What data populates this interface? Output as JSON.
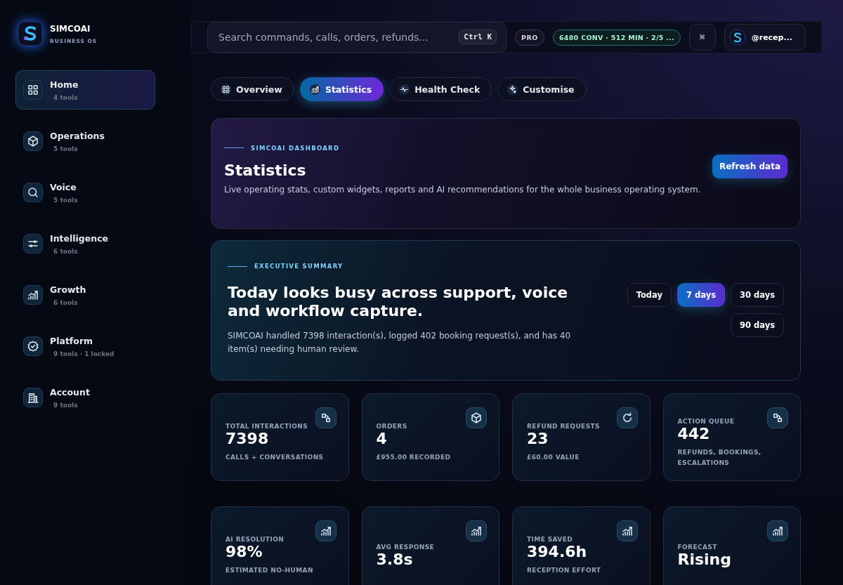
{
  "brand": {
    "name": "SIMCOAI",
    "tagline": "BUSINESS OS"
  },
  "sidebar": {
    "items": [
      {
        "label": "Home",
        "meta": "4 tools",
        "selected": true
      },
      {
        "label": "Operations",
        "meta": "5 tools",
        "selected": false
      },
      {
        "label": "Voice",
        "meta": "5 tools",
        "selected": false
      },
      {
        "label": "Intelligence",
        "meta": "6 tools",
        "selected": false
      },
      {
        "label": "Growth",
        "meta": "6 tools",
        "selected": false
      },
      {
        "label": "Platform",
        "meta": "9 tools · 1 locked",
        "selected": false
      },
      {
        "label": "Account",
        "meta": "9 tools",
        "selected": false
      }
    ]
  },
  "topbar": {
    "search": {
      "placeholder": "Search commands, calls, orders, refunds..."
    },
    "shortcut": "Ctrl K",
    "plan": "PRO",
    "usage": "6480 CONV · 512 MIN · 2/5 ...",
    "shortcut_icon": "⌘",
    "user": "@recep..."
  },
  "tabs": [
    {
      "label": "Overview",
      "selected": false
    },
    {
      "label": "Statistics",
      "selected": true
    },
    {
      "label": "Health Check",
      "selected": false
    },
    {
      "label": "Customise",
      "selected": false
    }
  ],
  "hero": {
    "eyebrow": "SIMCOAI DASHBOARD",
    "title": "Statistics",
    "subtitle": "Live operating stats, custom widgets, reports and AI recommendations for the whole business operating system.",
    "button": "Refresh data"
  },
  "summary": {
    "eyebrow": "EXECUTIVE SUMMARY",
    "title": "Today looks busy across support, voice and workflow capture.",
    "text": "SIMCOAI handled 7398 interaction(s), logged 402 booking request(s), and has 40 item(s) needing human review.",
    "ranges": [
      {
        "label": "Today",
        "selected": false
      },
      {
        "label": "7 days",
        "selected": true
      },
      {
        "label": "30 days",
        "selected": false
      },
      {
        "label": "90 days",
        "selected": false
      }
    ]
  },
  "stats": [
    {
      "label": "TOTAL INTERACTIONS",
      "value": "7398",
      "sub": "CALLS + CONVERSATIONS"
    },
    {
      "label": "ORDERS",
      "value": "4",
      "sub": "£955.00 RECORDED"
    },
    {
      "label": "REFUND REQUESTS",
      "value": "23",
      "sub": "£60.00 VALUE"
    },
    {
      "label": "ACTION QUEUE",
      "value": "442",
      "sub": "REFUNDS, BOOKINGS, ESCALATIONS"
    },
    {
      "label": "AI RESOLUTION",
      "value": "98%",
      "sub": "ESTIMATED NO-HUMAN"
    },
    {
      "label": "AVG RESPONSE",
      "value": "3.8s"
    },
    {
      "label": "TIME SAVED",
      "value": "394.6h",
      "sub": "RECEPTION EFFORT"
    },
    {
      "label": "FORECAST",
      "value": "Rising"
    }
  ]
}
